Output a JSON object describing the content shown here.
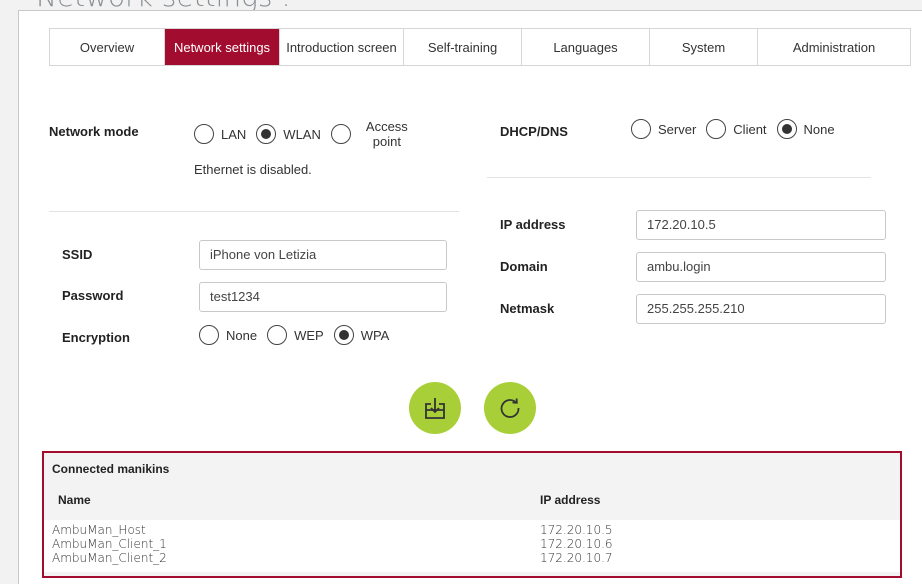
{
  "page": {
    "title": "Network settings :"
  },
  "tabs": [
    {
      "label": "Overview",
      "active": false
    },
    {
      "label": "Network settings",
      "active": true
    },
    {
      "label": "Introduction screen",
      "active": false
    },
    {
      "label": "Self-training",
      "active": false
    },
    {
      "label": "Languages",
      "active": false
    },
    {
      "label": "System",
      "active": false
    },
    {
      "label": "Administration",
      "active": false
    }
  ],
  "network_mode": {
    "label": "Network mode",
    "options": [
      "LAN",
      "WLAN",
      "Access point"
    ],
    "selected": "WLAN",
    "ethernet_note": "Ethernet is disabled."
  },
  "dhcp": {
    "label": "DHCP/DNS",
    "options": [
      "Server",
      "Client",
      "None"
    ],
    "selected": "None"
  },
  "wlan": {
    "ssid_label": "SSID",
    "ssid_value": "iPhone von Letizia",
    "password_label": "Password",
    "password_value": "test1234",
    "encryption_label": "Encryption",
    "encryption_options": [
      "None",
      "WEP",
      "WPA"
    ],
    "encryption_selected": "WPA"
  },
  "ip": {
    "ip_label": "IP address",
    "ip_value": "172.20.10.5",
    "domain_label": "Domain",
    "domain_value": "ambu.login",
    "netmask_label": "Netmask",
    "netmask_value": "255.255.255.210"
  },
  "actions": {
    "save_icon": "download-tray-icon",
    "refresh_icon": "refresh-icon",
    "accent_color": "#a9cf38"
  },
  "manikins": {
    "title": "Connected manikins",
    "col_name": "Name",
    "col_ip": "IP address",
    "rows": [
      {
        "name": "AmbuMan_Host",
        "ip": "172.20.10.5"
      },
      {
        "name": "AmbuMan_Client_1",
        "ip": "172.20.10.6"
      },
      {
        "name": "AmbuMan_Client_2",
        "ip": "172.20.10.7"
      }
    ]
  },
  "colors": {
    "brand": "#a20d2f",
    "accent": "#a9cf38"
  }
}
